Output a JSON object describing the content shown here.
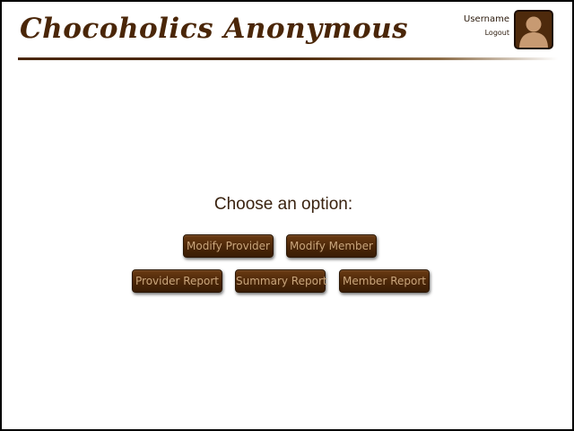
{
  "app": {
    "title": "Chocoholics Anonymous"
  },
  "user": {
    "username": "Username",
    "logout_label": "Logout",
    "avatar_icon": "user-silhouette-icon"
  },
  "main": {
    "prompt": "Choose an option:",
    "buttons": {
      "modify_provider": "Modify Provider",
      "modify_member": "Modify Member",
      "provider_report": "Provider Report",
      "summary_report": "Summary Report",
      "member_report": "Member Report"
    }
  },
  "colors": {
    "brand_brown": "#4a2608",
    "button_text": "#c9a57c",
    "avatar_background": "#4e2a0c",
    "avatar_figure": "#c79a72"
  }
}
